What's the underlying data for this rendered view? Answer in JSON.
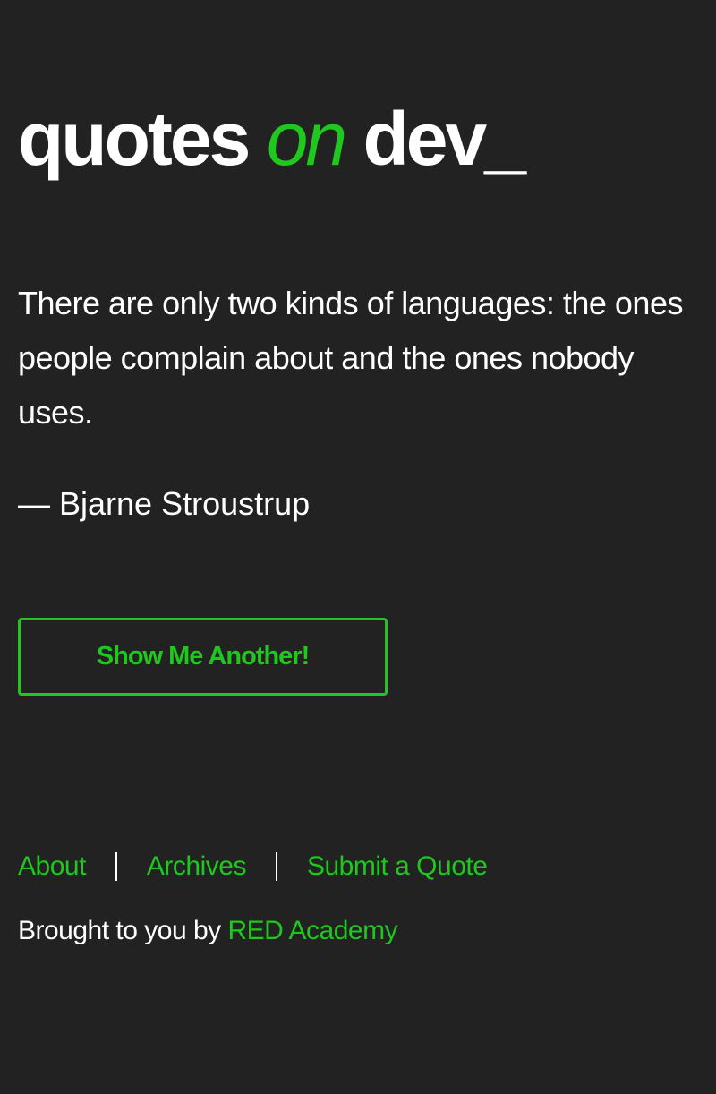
{
  "header": {
    "logo_part1": "quotes",
    "logo_part2": "on",
    "logo_part3": "dev_"
  },
  "quote": {
    "text": "There are only two kinds of languages: the ones people complain about and the ones nobody uses.",
    "author": "— Bjarne Stroustrup"
  },
  "actions": {
    "another_label": "Show Me Another!"
  },
  "footer": {
    "links": [
      {
        "label": "About"
      },
      {
        "label": "Archives"
      },
      {
        "label": "Submit a Quote"
      }
    ],
    "credit_prefix": "Brought to you by",
    "credit_link": "RED Academy"
  },
  "colors": {
    "accent": "#1fc71f",
    "background": "#222222",
    "text": "#ffffff"
  }
}
